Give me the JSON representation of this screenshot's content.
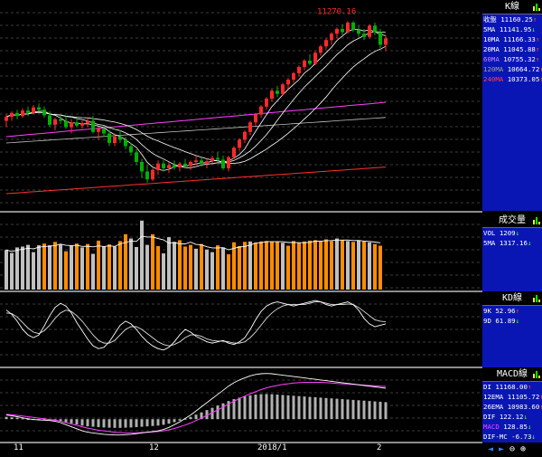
{
  "colors": {
    "up": "#ff2a2a",
    "down": "#00b000",
    "gold": "#ff8c00",
    "white": "#ffffff",
    "gray": "#c0c0c0",
    "purple": "#ff40ff",
    "red_ma": "#ff3030",
    "panel": "#0a16b4",
    "label_white": "#ffffff",
    "label_blue": "#40a0ff"
  },
  "price_panel": {
    "title": "K線",
    "high_label": "11270.16",
    "rows": [
      {
        "label": "收盤",
        "value": "11160.25",
        "arrow": "↑",
        "color": "#ffffff"
      },
      {
        "label": "5MA",
        "value": "11141.95",
        "arrow": "↓",
        "color": "#ffffff"
      },
      {
        "label": "10MA",
        "value": "11166.33",
        "arrow": "↑",
        "color": "#ffffff"
      },
      {
        "label": "20MA",
        "value": "11045.88",
        "arrow": "↑",
        "color": "#ffffff"
      },
      {
        "label": "60MA",
        "value": "10755.32",
        "arrow": "↑",
        "color": "#c080ff"
      },
      {
        "label": "120MA",
        "value": "10664.72",
        "arrow": "↑",
        "color": "#a0a0a0"
      },
      {
        "label": "240MA",
        "value": "10373.05",
        "arrow": "↑",
        "color": "#ff4040"
      }
    ]
  },
  "volume_panel": {
    "title": "成交量",
    "rows": [
      {
        "label": "VOL",
        "value": "1209",
        "arrow": "↓",
        "color": "#ffffff"
      },
      {
        "label": "5MA",
        "value": "1317.16",
        "arrow": "↓",
        "color": "#ffffff"
      }
    ]
  },
  "kd_panel": {
    "title": "KD線",
    "rows": [
      {
        "label": "9K",
        "value": "52.96",
        "arrow": "↑",
        "color": "#ffffff"
      },
      {
        "label": "9D",
        "value": "61.89",
        "arrow": "↓",
        "color": "#ffffff"
      }
    ]
  },
  "macd_panel": {
    "title": "MACD線",
    "rows": [
      {
        "label": "DI",
        "value": "11168.00",
        "arrow": "↑",
        "color": "#ffffff"
      },
      {
        "label": "12EMA",
        "value": "11105.72",
        "arrow": "↑",
        "color": "#ffffff"
      },
      {
        "label": "26EMA",
        "value": "10983.60",
        "arrow": "↑",
        "color": "#ffffff"
      },
      {
        "label": "DIF",
        "value": "122.12",
        "arrow": "↓",
        "color": "#ffffff"
      },
      {
        "label": "MACD",
        "value": "128.85",
        "arrow": "↓",
        "color": "#ff40ff"
      },
      {
        "label": "DIF-MC",
        "value": "-6.73",
        "arrow": "↓",
        "color": "#ffffff"
      }
    ]
  },
  "x_labels": [
    {
      "text": "11",
      "index": 2
    },
    {
      "text": "12",
      "index": 27
    },
    {
      "text": "2018/1",
      "index": 47
    },
    {
      "text": "2",
      "index": 69
    }
  ],
  "toolbar": {
    "left": "◄",
    "right": "►",
    "zoom_out": "⊖",
    "zoom_in": "⊕"
  },
  "chart_data": {
    "type": "candlestick",
    "ylim": [
      10100,
      11300
    ],
    "ohlc": [
      [
        10640,
        10680,
        10600,
        10665
      ],
      [
        10665,
        10700,
        10640,
        10690
      ],
      [
        10690,
        10710,
        10650,
        10670
      ],
      [
        10670,
        10720,
        10660,
        10705
      ],
      [
        10705,
        10730,
        10670,
        10690
      ],
      [
        10690,
        10740,
        10680,
        10725
      ],
      [
        10725,
        10750,
        10700,
        10710
      ],
      [
        10710,
        10730,
        10660,
        10675
      ],
      [
        10675,
        10700,
        10600,
        10615
      ],
      [
        10615,
        10660,
        10580,
        10650
      ],
      [
        10650,
        10680,
        10620,
        10640
      ],
      [
        10640,
        10670,
        10590,
        10600
      ],
      [
        10600,
        10650,
        10560,
        10630
      ],
      [
        10630,
        10660,
        10600,
        10610
      ],
      [
        10610,
        10640,
        10590,
        10625
      ],
      [
        10625,
        10660,
        10600,
        10640
      ],
      [
        10640,
        10670,
        10560,
        10570
      ],
      [
        10570,
        10600,
        10520,
        10590
      ],
      [
        10590,
        10610,
        10540,
        10560
      ],
      [
        10560,
        10580,
        10480,
        10500
      ],
      [
        10500,
        10560,
        10480,
        10540
      ],
      [
        10540,
        10580,
        10500,
        10520
      ],
      [
        10520,
        10540,
        10460,
        10480
      ],
      [
        10480,
        10500,
        10420,
        10440
      ],
      [
        10440,
        10460,
        10360,
        10380
      ],
      [
        10380,
        10400,
        10280,
        10320
      ],
      [
        10320,
        10360,
        10250,
        10270
      ],
      [
        10270,
        10340,
        10260,
        10330
      ],
      [
        10330,
        10390,
        10300,
        10370
      ],
      [
        10370,
        10390,
        10320,
        10340
      ],
      [
        10340,
        10380,
        10310,
        10360
      ],
      [
        10360,
        10390,
        10330,
        10345
      ],
      [
        10345,
        10380,
        10320,
        10370
      ],
      [
        10370,
        10400,
        10340,
        10355
      ],
      [
        10355,
        10390,
        10330,
        10380
      ],
      [
        10380,
        10420,
        10360,
        10390
      ],
      [
        10390,
        10410,
        10350,
        10370
      ],
      [
        10370,
        10400,
        10340,
        10385
      ],
      [
        10385,
        10420,
        10370,
        10405
      ],
      [
        10405,
        10440,
        10380,
        10395
      ],
      [
        10395,
        10420,
        10330,
        10340
      ],
      [
        10340,
        10420,
        10320,
        10410
      ],
      [
        10410,
        10480,
        10400,
        10470
      ],
      [
        10470,
        10530,
        10450,
        10520
      ],
      [
        10520,
        10580,
        10500,
        10570
      ],
      [
        10570,
        10640,
        10550,
        10630
      ],
      [
        10630,
        10690,
        10610,
        10680
      ],
      [
        10680,
        10740,
        10660,
        10730
      ],
      [
        10730,
        10790,
        10710,
        10780
      ],
      [
        10780,
        10840,
        10760,
        10830
      ],
      [
        10830,
        10860,
        10790,
        10810
      ],
      [
        10810,
        10880,
        10800,
        10870
      ],
      [
        10870,
        10910,
        10840,
        10900
      ],
      [
        10900,
        10950,
        10880,
        10940
      ],
      [
        10940,
        10990,
        10920,
        10980
      ],
      [
        10980,
        11030,
        10960,
        11020
      ],
      [
        11020,
        11060,
        10990,
        11000
      ],
      [
        11000,
        11080,
        10990,
        11070
      ],
      [
        11070,
        11120,
        11050,
        11110
      ],
      [
        11110,
        11160,
        11090,
        11150
      ],
      [
        11150,
        11200,
        11120,
        11190
      ],
      [
        11190,
        11230,
        11160,
        11220
      ],
      [
        11220,
        11250,
        11180,
        11200
      ],
      [
        11200,
        11270,
        11190,
        11260
      ],
      [
        11260,
        11270,
        11200,
        11215
      ],
      [
        11215,
        11240,
        11170,
        11190
      ],
      [
        11190,
        11220,
        11150,
        11170
      ],
      [
        11170,
        11250,
        11160,
        11240
      ],
      [
        11240,
        11260,
        11180,
        11200
      ],
      [
        11200,
        11220,
        11100,
        11120
      ],
      [
        11120,
        11180,
        11080,
        11160
      ]
    ],
    "volume": [
      [
        930,
        "w"
      ],
      [
        860,
        "w"
      ],
      [
        990,
        "w"
      ],
      [
        1010,
        "w"
      ],
      [
        1050,
        "w"
      ],
      [
        880,
        "w"
      ],
      [
        1040,
        "w"
      ],
      [
        1080,
        "o"
      ],
      [
        1040,
        "w"
      ],
      [
        1120,
        "o"
      ],
      [
        1060,
        "w"
      ],
      [
        900,
        "o"
      ],
      [
        1040,
        "w"
      ],
      [
        1080,
        "o"
      ],
      [
        990,
        "w"
      ],
      [
        1070,
        "o"
      ],
      [
        840,
        "w"
      ],
      [
        1150,
        "o"
      ],
      [
        1010,
        "w"
      ],
      [
        1060,
        "o"
      ],
      [
        1010,
        "w"
      ],
      [
        1140,
        "o"
      ],
      [
        1300,
        "o"
      ],
      [
        1200,
        "w"
      ],
      [
        1000,
        "w"
      ],
      [
        1620,
        "w"
      ],
      [
        1050,
        "w"
      ],
      [
        1300,
        "o"
      ],
      [
        1020,
        "o"
      ],
      [
        850,
        "w"
      ],
      [
        1230,
        "w"
      ],
      [
        1120,
        "w"
      ],
      [
        1160,
        "o"
      ],
      [
        1010,
        "o"
      ],
      [
        1050,
        "o"
      ],
      [
        960,
        "w"
      ],
      [
        1070,
        "o"
      ],
      [
        940,
        "w"
      ],
      [
        880,
        "w"
      ],
      [
        1040,
        "o"
      ],
      [
        990,
        "w"
      ],
      [
        830,
        "o"
      ],
      [
        1110,
        "o"
      ],
      [
        1020,
        "o"
      ],
      [
        1120,
        "o"
      ],
      [
        1130,
        "w"
      ],
      [
        1100,
        "o"
      ],
      [
        1130,
        "o"
      ],
      [
        1140,
        "o"
      ],
      [
        1120,
        "o"
      ],
      [
        1130,
        "o"
      ],
      [
        1100,
        "w"
      ],
      [
        1030,
        "o"
      ],
      [
        1140,
        "o"
      ],
      [
        1100,
        "o"
      ],
      [
        1130,
        "o"
      ],
      [
        1150,
        "o"
      ],
      [
        1160,
        "o"
      ],
      [
        1130,
        "o"
      ],
      [
        1180,
        "o"
      ],
      [
        1140,
        "o"
      ],
      [
        1200,
        "w"
      ],
      [
        1160,
        "o"
      ],
      [
        1140,
        "w"
      ],
      [
        1120,
        "o"
      ],
      [
        1150,
        "w"
      ],
      [
        1130,
        "o"
      ],
      [
        1110,
        "w"
      ],
      [
        1070,
        "o"
      ],
      [
        1030,
        "o"
      ]
    ],
    "vol_ylim": [
      0,
      1700
    ],
    "kd_ylim": [
      0,
      100
    ],
    "k": [
      78,
      72,
      62,
      50,
      42,
      38,
      42,
      55,
      70,
      82,
      88,
      84,
      74,
      60,
      48,
      36,
      26,
      22,
      24,
      32,
      44,
      56,
      62,
      58,
      50,
      40,
      32,
      26,
      22,
      20,
      24,
      32,
      42,
      50,
      46,
      40,
      36,
      32,
      30,
      32,
      34,
      30,
      28,
      32,
      38,
      50,
      64,
      76,
      84,
      88,
      90,
      88,
      86,
      84,
      86,
      88,
      90,
      92,
      90,
      86,
      84,
      86,
      88,
      90,
      86,
      78,
      66,
      58,
      54,
      56,
      58
    ],
    "d": [
      74,
      73,
      68,
      60,
      52,
      46,
      44,
      48,
      56,
      66,
      74,
      78,
      76,
      70,
      62,
      52,
      42,
      34,
      30,
      30,
      34,
      42,
      50,
      54,
      54,
      50,
      44,
      38,
      32,
      28,
      26,
      28,
      32,
      38,
      42,
      42,
      40,
      36,
      34,
      33,
      33,
      32,
      30,
      30,
      32,
      38,
      46,
      56,
      66,
      74,
      80,
      84,
      86,
      86,
      86,
      86,
      88,
      90,
      90,
      88,
      86,
      86,
      86,
      87,
      86,
      82,
      76,
      70,
      64,
      62,
      61
    ],
    "dif": [
      12,
      10,
      7,
      4,
      1,
      -1,
      -2,
      -3,
      -4,
      -6,
      -10,
      -16,
      -22,
      -28,
      -34,
      -38,
      -40,
      -42,
      -44,
      -45,
      -46,
      -46,
      -45,
      -44,
      -42,
      -40,
      -38,
      -36,
      -34,
      -30,
      -24,
      -16,
      -8,
      2,
      12,
      24,
      36,
      48,
      60,
      72,
      84,
      96,
      106,
      114,
      120,
      126,
      130,
      132,
      133,
      132,
      130,
      128,
      126,
      124,
      122,
      120,
      118,
      116,
      114,
      112,
      110,
      108,
      106,
      104,
      102,
      100,
      98,
      96,
      94,
      92,
      90
    ],
    "macd": [
      14,
      13,
      11,
      9,
      7,
      5,
      3,
      1,
      -1,
      -3,
      -6,
      -10,
      -14,
      -18,
      -22,
      -26,
      -29,
      -32,
      -34,
      -36,
      -38,
      -39,
      -40,
      -40,
      -40,
      -39,
      -38,
      -37,
      -36,
      -34,
      -31,
      -27,
      -22,
      -17,
      -11,
      -4,
      3,
      11,
      19,
      27,
      35,
      44,
      52,
      60,
      67,
      74,
      80,
      86,
      91,
      95,
      98,
      101,
      103,
      105,
      106,
      107,
      107,
      107,
      107,
      106,
      105,
      104,
      103,
      102,
      101,
      100,
      99,
      98,
      97,
      96,
      95
    ],
    "macd_ylim": [
      -60,
      140
    ]
  }
}
